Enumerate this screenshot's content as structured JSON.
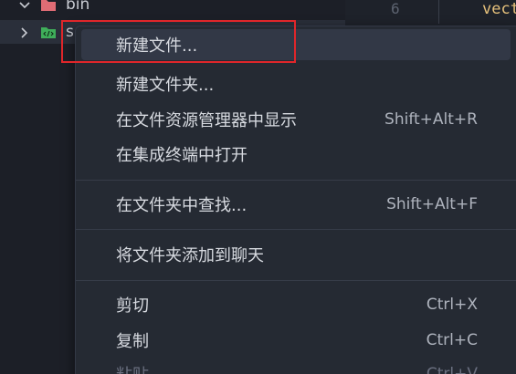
{
  "explorer": {
    "rows": [
      {
        "label": "bin",
        "icon": "folder-red-icon",
        "expanded": true
      },
      {
        "label": "s",
        "icon": "folder-code-icon",
        "expanded": false
      }
    ]
  },
  "editor": {
    "line_number": "6",
    "code": "vect"
  },
  "context_menu": {
    "items": [
      {
        "label": "新建文件...",
        "shortcut": ""
      },
      {
        "label": "新建文件夹...",
        "shortcut": ""
      },
      {
        "label": "在文件资源管理器中显示",
        "shortcut": "Shift+Alt+R"
      },
      {
        "label": "在集成终端中打开",
        "shortcut": ""
      },
      {
        "label": "在文件夹中查找...",
        "shortcut": "Shift+Alt+F"
      },
      {
        "label": "将文件夹添加到聊天",
        "shortcut": ""
      },
      {
        "label": "剪切",
        "shortcut": "Ctrl+X"
      },
      {
        "label": "复制",
        "shortcut": "Ctrl+C"
      },
      {
        "label": "粘贴",
        "shortcut": "Ctrl+V"
      }
    ]
  },
  "colors": {
    "background": "#1b1e26",
    "menu_background": "#252a33",
    "menu_highlight": "#323846",
    "annotation": "#e0262a",
    "code_keyword": "#e5c07b"
  }
}
